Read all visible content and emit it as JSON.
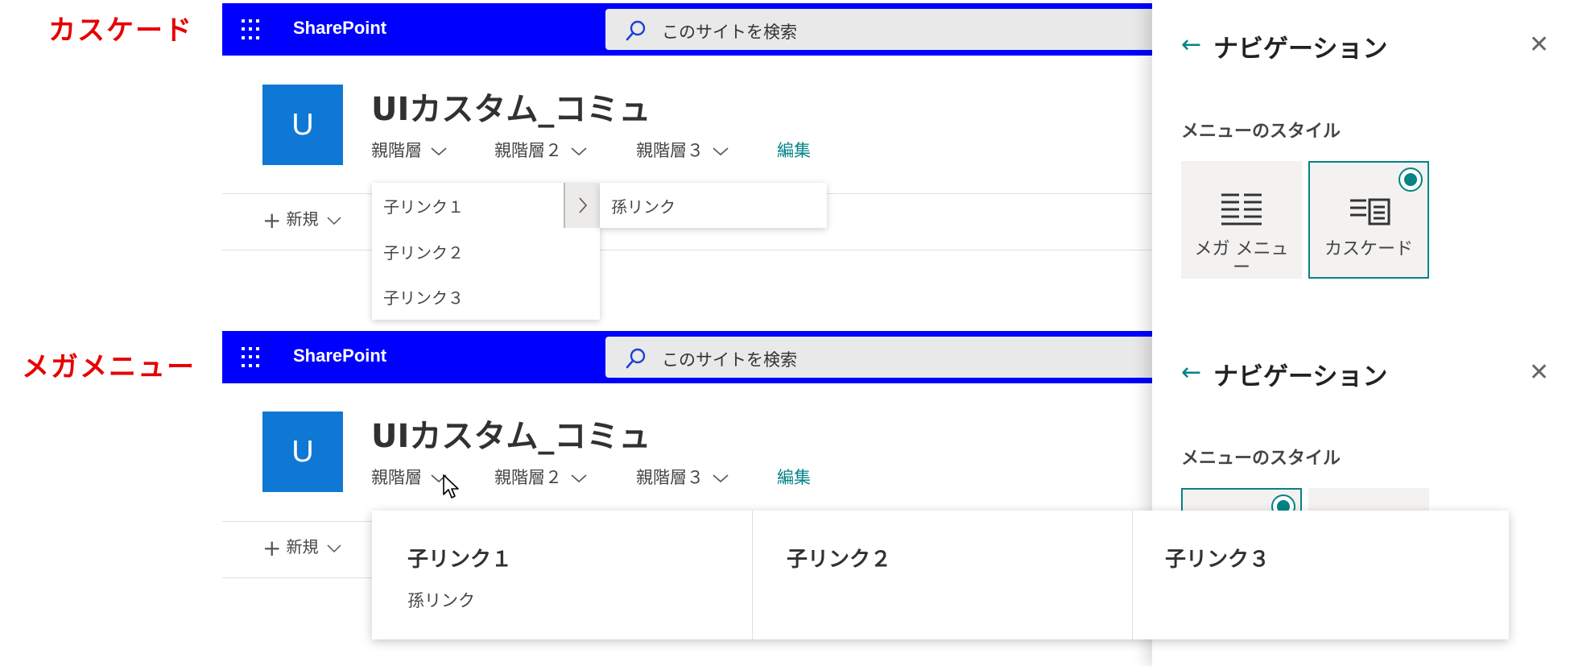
{
  "labels": {
    "cascade": "カスケード",
    "mega": "メガメニュー"
  },
  "suite": {
    "brand": "SharePoint",
    "search_placeholder": "このサイトを検索"
  },
  "site": {
    "logo_letter": "U",
    "title": "UIカスタム_コミュ",
    "nav": [
      "親階層",
      "親階層２",
      "親階層３"
    ],
    "edit": "編集",
    "new_label": "新規"
  },
  "cascade_menu": {
    "children": [
      "子リンク１",
      "子リンク２",
      "子リンク３"
    ],
    "grandchild": "孫リンク"
  },
  "mega_menu": {
    "columns": [
      {
        "heading": "子リンク１",
        "link": "孫リンク"
      },
      {
        "heading": "子リンク２"
      },
      {
        "heading": "子リンク３"
      }
    ]
  },
  "panel": {
    "title": "ナビゲーション",
    "menu_style_label": "メニューのスタイル",
    "options": [
      {
        "line1": "メガ メニュ",
        "line2": "ー"
      },
      {
        "line1": "カスケード"
      }
    ]
  },
  "colors": {
    "suite_bar": "#0000ff",
    "accent": "#038387",
    "logo": "#0f78d4",
    "label_red": "#e60000"
  }
}
